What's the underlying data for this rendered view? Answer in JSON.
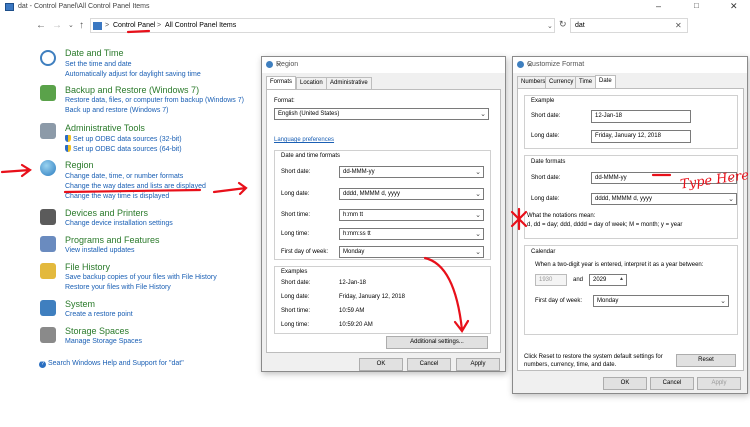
{
  "window": {
    "title": "dat - Control Panel\\All Control Panel Items"
  },
  "address": {
    "crumb1": "Control Panel",
    "sep": ">",
    "crumb2": "All Control Panel Items",
    "search_value": "dat"
  },
  "items": [
    {
      "title": "Date and Time",
      "links": [
        "Set the time and date",
        "Automatically adjust for daylight saving time"
      ]
    },
    {
      "title": "Backup and Restore (Windows 7)",
      "links": [
        "Restore data, files, or computer from backup (Windows 7)",
        "Back up and restore (Windows 7)"
      ]
    },
    {
      "title": "Administrative Tools",
      "links": [
        "Set up ODBC data sources (32-bit)",
        "Set up ODBC data sources (64-bit)"
      ]
    },
    {
      "title": "Region",
      "links": [
        "Change date, time, or number formats",
        "Change the way dates and lists are displayed",
        "Change the way time is displayed"
      ]
    },
    {
      "title": "Devices and Printers",
      "links": [
        "Change device installation settings"
      ]
    },
    {
      "title": "Programs and Features",
      "links": [
        "View installed updates"
      ]
    },
    {
      "title": "File History",
      "links": [
        "Save backup copies of your files with File History",
        "Restore your files with File History"
      ]
    },
    {
      "title": "System",
      "links": [
        "Create a restore point"
      ]
    },
    {
      "title": "Storage Spaces",
      "links": [
        "Manage Storage Spaces"
      ]
    }
  ],
  "help_link": "Search Windows Help and Support for \"dat\"",
  "region": {
    "title": "Region",
    "tabs": [
      "Formats",
      "Location",
      "Administrative"
    ],
    "format_label": "Format:",
    "format_value": "English (United States)",
    "lang_pref": "Language preferences",
    "group_title": "Date and time formats",
    "rows": [
      {
        "label": "Short date:",
        "value": "dd-MMM-yy"
      },
      {
        "label": "Long date:",
        "value": "dddd, MMMM d, yyyy"
      },
      {
        "label": "Short time:",
        "value": "h:mm tt"
      },
      {
        "label": "Long time:",
        "value": "h:mm:ss tt"
      },
      {
        "label": "First day of week:",
        "value": "Monday"
      }
    ],
    "examples_title": "Examples",
    "examples": [
      {
        "label": "Short date:",
        "value": "12-Jan-18"
      },
      {
        "label": "Long date:",
        "value": "Friday, January 12, 2018"
      },
      {
        "label": "Short time:",
        "value": "10:59 AM"
      },
      {
        "label": "Long time:",
        "value": "10:59:20 AM"
      }
    ],
    "additional": "Additional settings...",
    "ok": "OK",
    "cancel": "Cancel",
    "apply": "Apply"
  },
  "custom": {
    "title": "Customize Format",
    "tabs": [
      "Numbers",
      "Currency",
      "Time",
      "Date"
    ],
    "example_title": "Example",
    "ex_short_label": "Short date:",
    "ex_short_value": "12-Jan-18",
    "ex_long_label": "Long date:",
    "ex_long_value": "Friday, January 12, 2018",
    "formats_title": "Date formats",
    "fmt_short_label": "Short date:",
    "fmt_short_value": "dd-MMM-yy",
    "fmt_long_label": "Long date:",
    "fmt_long_value": "dddd, MMMM d, yyyy",
    "notation_title": "What the notations mean:",
    "notation_text": "d, dd = day;  ddd, dddd = day of week;  M = month;  y = year",
    "calendar_title": "Calendar",
    "calendar_text": "When a two-digit year is entered, interpret it as a year between:",
    "year_from": "1930",
    "and_label": "and",
    "year_to": "2029",
    "fdw_label": "First day of week:",
    "fdw_value": "Monday",
    "reset_text": "Click Reset to restore the system default settings for numbers, currency, time, and date.",
    "reset": "Reset",
    "ok": "OK",
    "cancel": "Cancel",
    "apply": "Apply"
  },
  "annotation": {
    "text": "Type Here",
    "color": "#e8101a"
  }
}
